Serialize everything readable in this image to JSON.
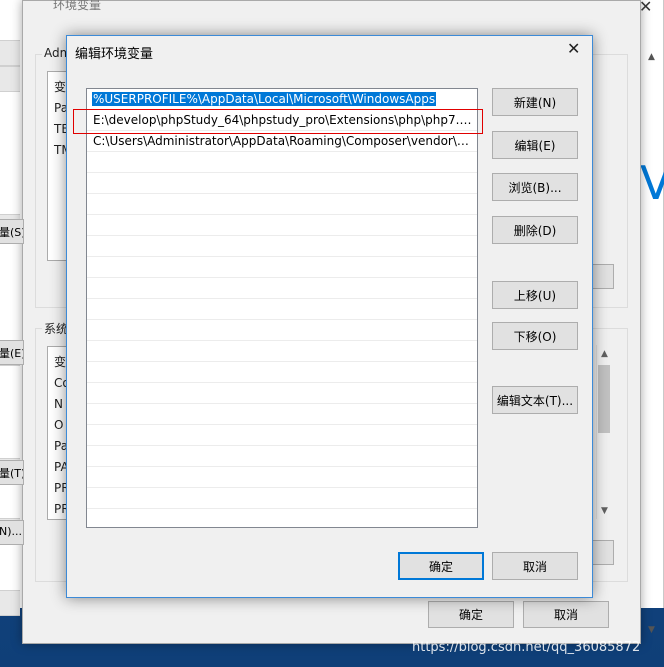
{
  "background": {
    "far_window": {
      "big_letter": "V"
    },
    "env_dialog": {
      "title": "环境变量",
      "user_group_label": "Adm",
      "user_list_header": "变",
      "user_list_items": [
        "Pa",
        "TE",
        "TM"
      ],
      "system_group_label": "系统",
      "system_list_header": "变",
      "system_list_items": [
        "Co",
        "N",
        "O",
        "Pa",
        "PA",
        "PR",
        "PR"
      ],
      "partial_buttons": [
        "量(S)...",
        "量(E)...",
        "量(T)...",
        "N)..."
      ],
      "ok_label": "确定",
      "cancel_label": "取消"
    },
    "watermark": "https://blog.csdn.net/qq_36085872"
  },
  "edit_dialog": {
    "title": "编辑环境变量",
    "paths": [
      "%USERPROFILE%\\AppData\\Local\\Microsoft\\WindowsApps",
      "E:\\develop\\phpStudy_64\\phpstudy_pro\\Extensions\\php\\php7.3....",
      "C:\\Users\\Administrator\\AppData\\Roaming\\Composer\\vendor\\b..."
    ],
    "selected_index": 0,
    "highlighted_index": 1,
    "buttons": {
      "new": "新建(N)",
      "edit": "编辑(E)",
      "browse": "浏览(B)...",
      "delete": "删除(D)",
      "move_up": "上移(U)",
      "move_down": "下移(O)",
      "edit_text": "编辑文本(T)..."
    },
    "ok_label": "确定",
    "cancel_label": "取消"
  },
  "colors": {
    "selection": "#0078d7",
    "highlight_box": "#e00000",
    "dialog_bg": "#f0f0f0"
  }
}
